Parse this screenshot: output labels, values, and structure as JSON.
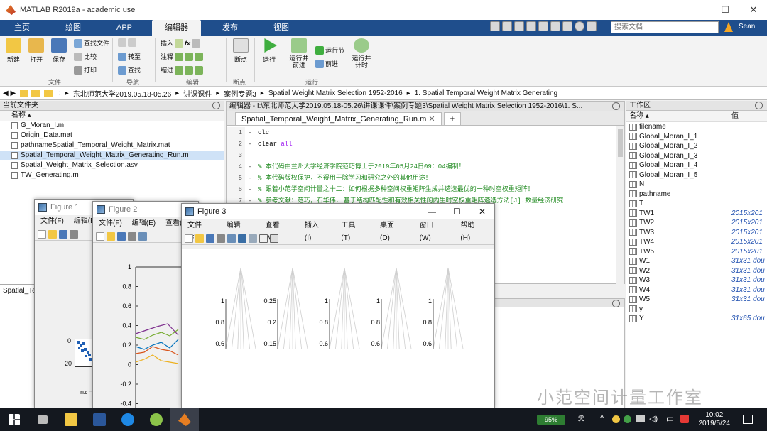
{
  "window": {
    "title": "MATLAB R2019a - academic use",
    "minimize": "—",
    "maximize": "☐",
    "close": "✕"
  },
  "tabs": [
    "主页",
    "绘图",
    "APP",
    "编辑器",
    "发布",
    "视图"
  ],
  "search_placeholder": "搜索文档",
  "user": "Sean",
  "ribbon": {
    "new": "新建",
    "open": "打开",
    "save": "保存",
    "find_files": "查找文件",
    "compare": "比较",
    "print": "打印",
    "goto": "转至",
    "find": "查找",
    "insert": "插入",
    "comment": "注释",
    "indent": "缩进",
    "breakpoints": "断点",
    "run": "运行",
    "run_advance": "运行并\n前进",
    "run_section": "运行节",
    "advance": "前进",
    "run_time": "运行并\n计时",
    "group_file": "文件",
    "group_nav": "导航",
    "group_edit": "编辑",
    "group_bp": "断点",
    "group_run": "运行"
  },
  "address": [
    "I:",
    "东北师范大学2019.05.18-05.26",
    "讲课课件",
    "案例专题3",
    "Spatial Weight Matrix Selection 1952-2016",
    "1. Spatial Temporal Weight Matrix Generating"
  ],
  "current_folder": {
    "header": "当前文件夹",
    "col_name": "名称 ▴",
    "files": [
      {
        "name": "G_Moran_I.m",
        "selected": false
      },
      {
        "name": "Origin_Data.mat",
        "selected": false
      },
      {
        "name": "pathnameSpatial_Temporal_Weight_Matrix.mat",
        "selected": false
      },
      {
        "name": "Spatial_Temporal_Weight_Matrix_Generating_Run.m",
        "selected": true
      },
      {
        "name": "Spatial_Weight_Matrix_Selection.asv",
        "selected": false
      },
      {
        "name": "TW_Generating.m",
        "selected": false
      }
    ],
    "lower_label": "Spatial_Te"
  },
  "editor": {
    "header": "编辑器 - I:\\东北师范大学2019.05.18-05.26\\讲课课件\\案例专题3\\Spatial Weight Matrix Selection 1952-2016\\1. S...",
    "tab": "Spatial_Temporal_Weight_Matrix_Generating_Run.m",
    "lines": [
      {
        "n": "1",
        "code": "clc",
        "cls": ""
      },
      {
        "n": "2",
        "code": "clear all",
        "cls": "kwmix"
      },
      {
        "n": "3",
        "code": "",
        "cls": ""
      },
      {
        "n": "4",
        "code": "% 本代码由兰州大学经济学院范巧博士于2019年05月24日09：04编制！",
        "cls": "cm"
      },
      {
        "n": "5",
        "code": "% 本代码版权保护，不得用于除学习和研究之外的其他用途！",
        "cls": "cm"
      },
      {
        "n": "6",
        "code": "% 跟着小范学空间计量之十二：如何根据多种空间权重矩阵生成并遴选最优的一种时空权重矩阵！",
        "cls": "cm"
      },
      {
        "n": "7",
        "code": "% 参考文献：范巧，石华伟. 基于结构匹配性和有效相关性的内生时空权重矩阵遴选方法[J].数量经济研究",
        "cls": "cm"
      },
      {
        "n": "8",
        "code": "时空权重矩阵构建方法[J].数量经",
        "cls": "cm"
      }
    ]
  },
  "workspace": {
    "header": "工作区",
    "col_name": "名称 ▴",
    "col_value": "值",
    "vars": [
      {
        "name": "filename",
        "value": ""
      },
      {
        "name": "Global_Moran_I_1",
        "value": ""
      },
      {
        "name": "Global_Moran_I_2",
        "value": ""
      },
      {
        "name": "Global_Moran_I_3",
        "value": ""
      },
      {
        "name": "Global_Moran_I_4",
        "value": ""
      },
      {
        "name": "Global_Moran_I_5",
        "value": ""
      },
      {
        "name": "N",
        "value": ""
      },
      {
        "name": "pathname",
        "value": ""
      },
      {
        "name": "T",
        "value": ""
      },
      {
        "name": "TW1",
        "value": "2015x201"
      },
      {
        "name": "TW2",
        "value": "2015x201"
      },
      {
        "name": "TW3",
        "value": "2015x201"
      },
      {
        "name": "TW4",
        "value": "2015x201"
      },
      {
        "name": "TW5",
        "value": "2015x201"
      },
      {
        "name": "W1",
        "value": "31x31 dou"
      },
      {
        "name": "W2",
        "value": "31x31 dou"
      },
      {
        "name": "W3",
        "value": "31x31 dou"
      },
      {
        "name": "W4",
        "value": "31x31 dou"
      },
      {
        "name": "W5",
        "value": "31x31 dou"
      },
      {
        "name": "y",
        "value": ""
      },
      {
        "name": "Y",
        "value": "31x65 dou"
      }
    ]
  },
  "figures": {
    "fig1": {
      "title": "Figure 1",
      "menu": [
        "文件(F)",
        "编辑(E)"
      ],
      "ticks": [
        "0",
        "20"
      ],
      "nz": "nz ="
    },
    "fig2": {
      "title": "Figure 2",
      "menu": [
        "文件(F)",
        "编辑(E)",
        "查看(V"
      ],
      "yticks": [
        "1",
        "0.8",
        "0.6",
        "0.4",
        "0.2",
        "0",
        "-0.2",
        "-0.4"
      ]
    },
    "fig3": {
      "title": "Figure 3",
      "menu": [
        "文件(F)",
        "编辑(E)",
        "查看(V)",
        "插入(I)",
        "工具(T)",
        "桌面(D)",
        "窗口(W)",
        "帮助(H)"
      ],
      "panels": [
        {
          "ticks": [
            "1",
            "0.8",
            "0.6"
          ]
        },
        {
          "ticks": [
            "0.25",
            "0.2",
            "0.15"
          ]
        },
        {
          "ticks": [
            "1",
            "0.8",
            "0.6"
          ]
        },
        {
          "ticks": [
            "1",
            "0.8",
            "0.6"
          ]
        },
        {
          "ticks": [
            "1",
            "0.8",
            "0.6"
          ]
        }
      ]
    }
  },
  "watermark": "小范空间计量工作室",
  "taskbar": {
    "battery": "95%",
    "ime": "中",
    "time": "10:02",
    "date": "2019/5/24"
  }
}
